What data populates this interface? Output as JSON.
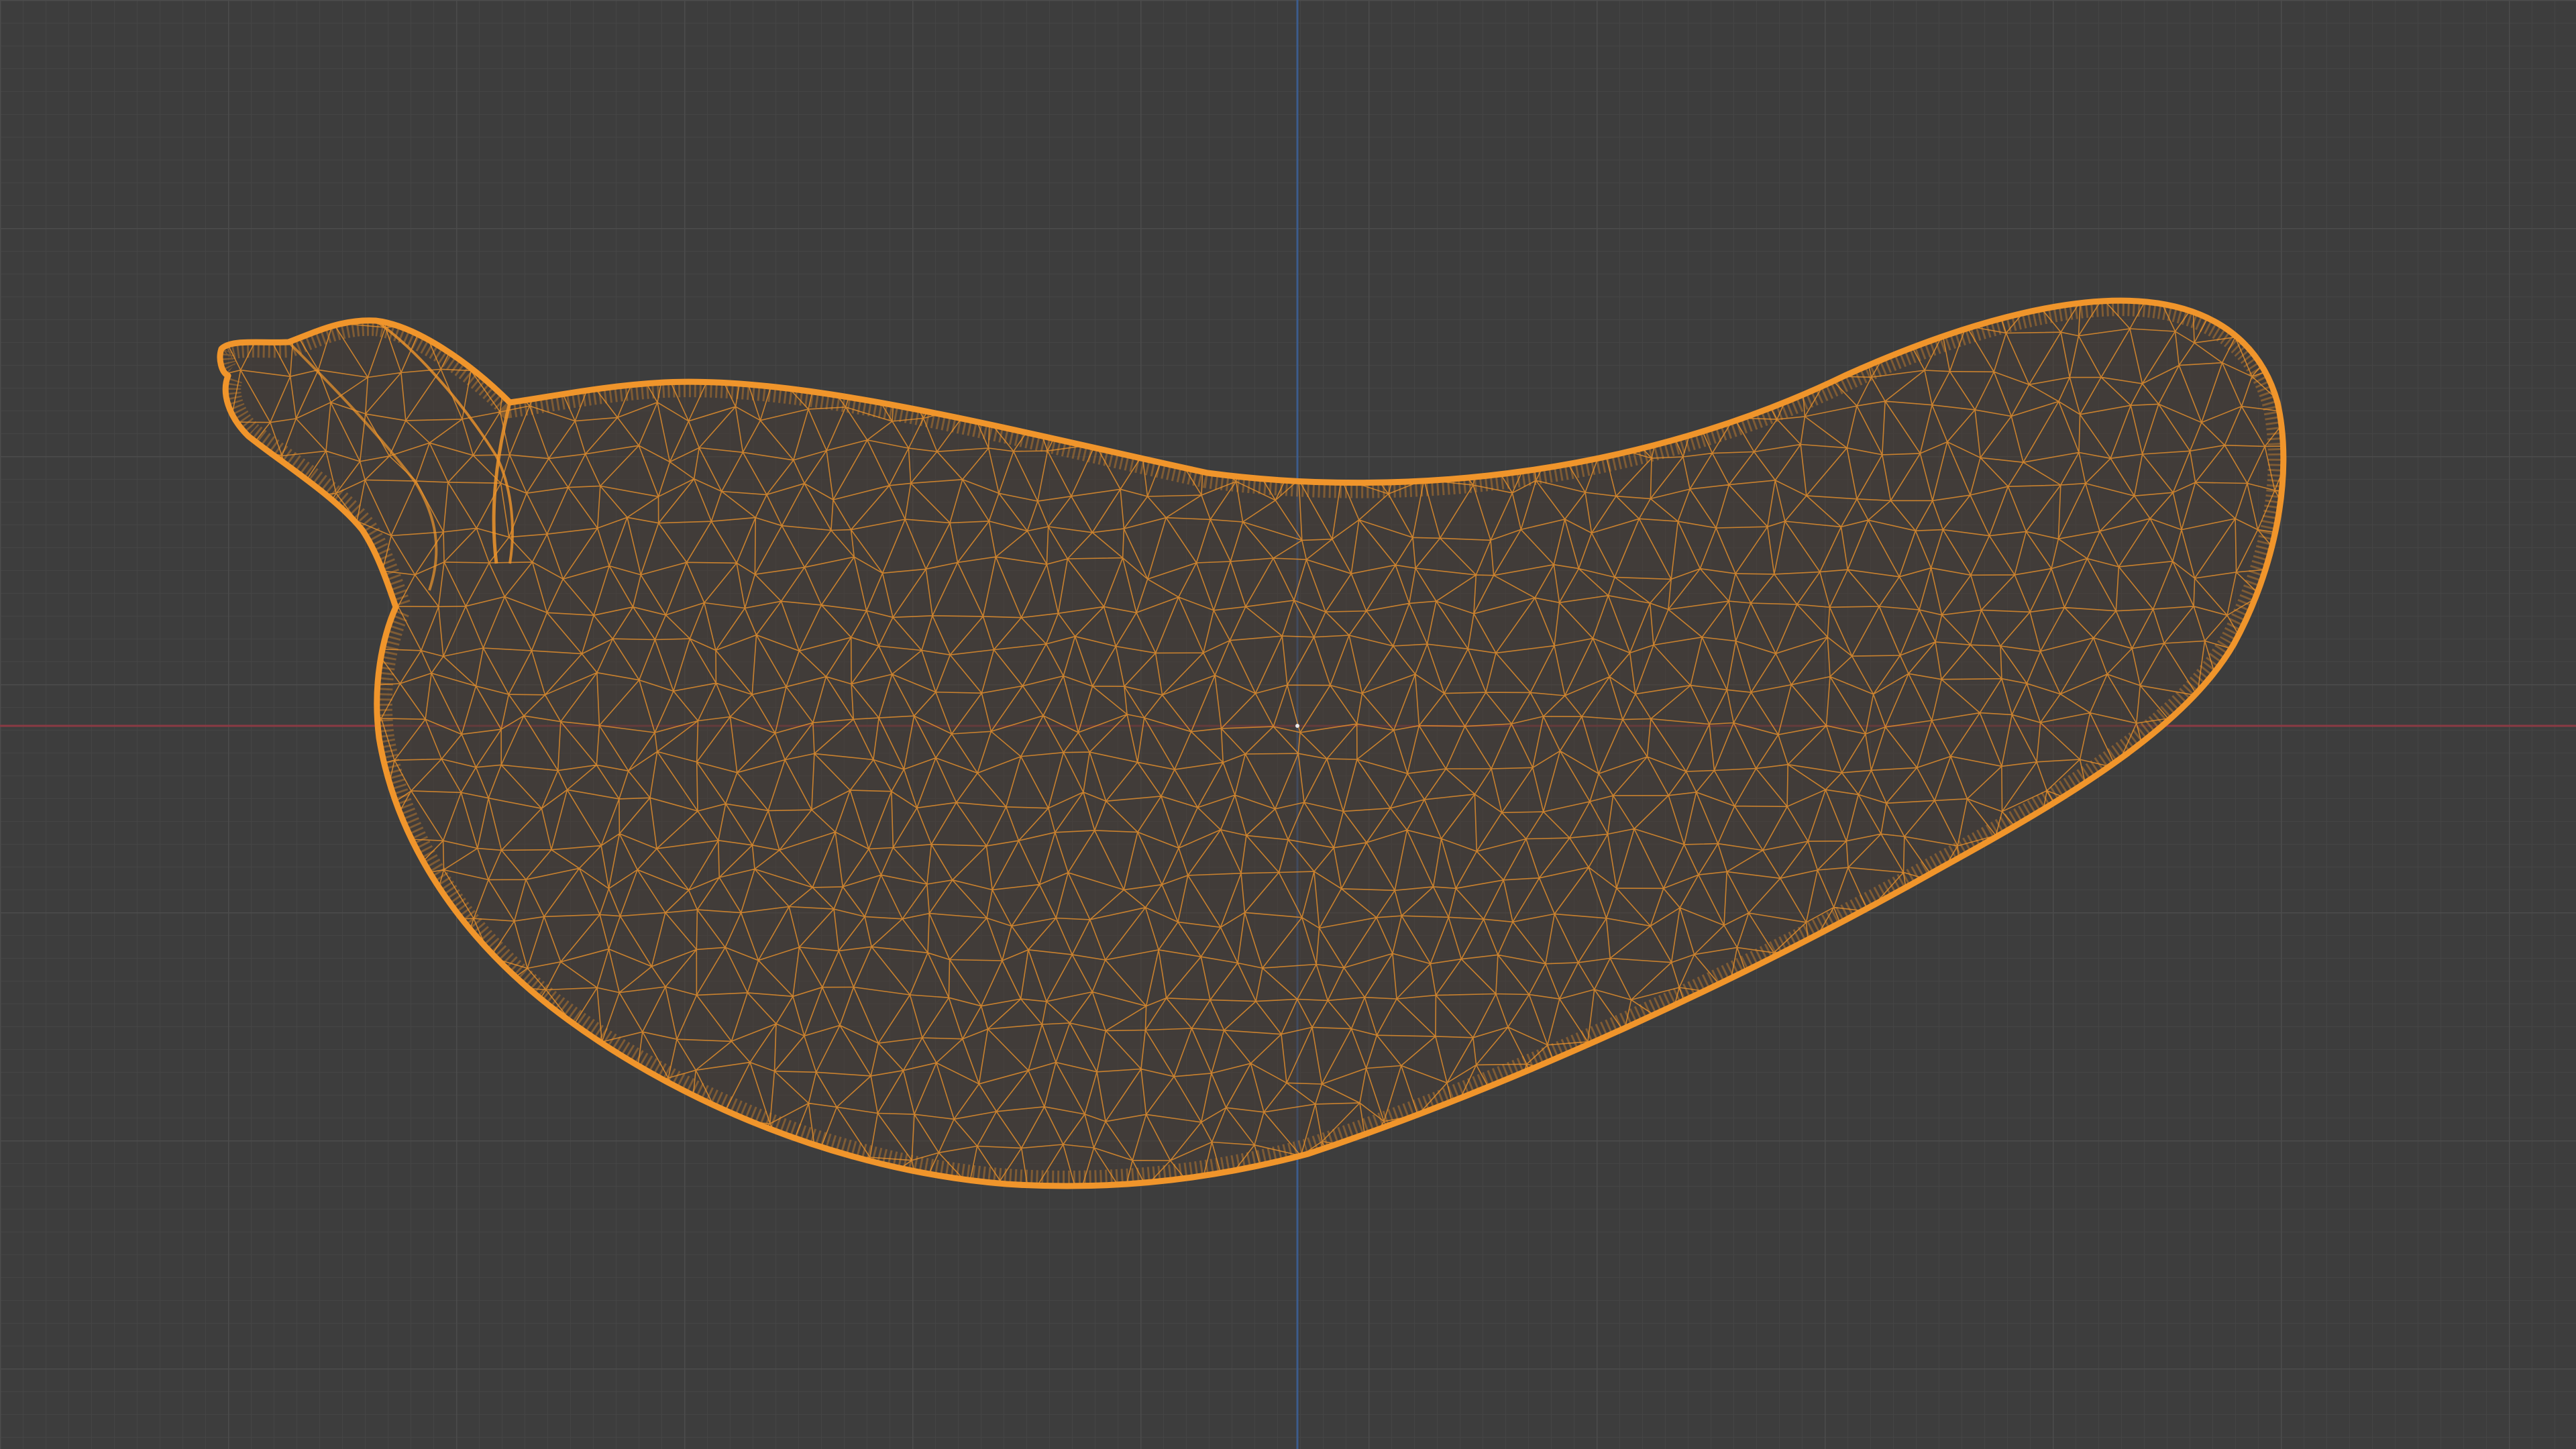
{
  "viewport": {
    "view": "front-orthographic",
    "shading": "wireframe",
    "grid": true,
    "object": {
      "name": "",
      "selected": true,
      "state": "active-selected"
    }
  },
  "colors": {
    "background": "#3d3d3d",
    "grid_minor": "#454545",
    "grid_major": "#4c4c4c",
    "axis_x": "#8a3a44",
    "axis_z": "#3c5c8c",
    "wire_selected": "#f0952b",
    "wire_selected_dim": "#d98a2e",
    "object_fill": "#4a4038"
  }
}
